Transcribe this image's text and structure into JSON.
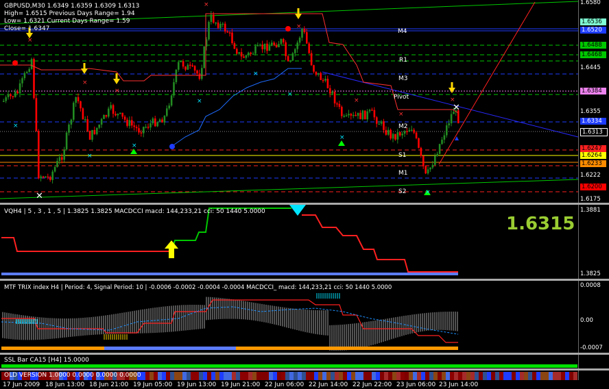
{
  "main": {
    "symbol_line": "GBPUSD,M30  1.6349 1.6359 1.6309 1.6313",
    "high_line": "High= 1.6515    Previous Days Range= 1.94",
    "low_line": "Low= 1.6321     Current Days Range= 1.59",
    "close_line": "Close= 1.6347",
    "levels": [
      "M4",
      "R1",
      "M3",
      "Pivot",
      "M2",
      "S1",
      "M1",
      "S2"
    ],
    "y_ticks": [
      "1.6580",
      "1.6445",
      "1.6355",
      "1.6313",
      "1.6222",
      "1.6175"
    ],
    "price_boxes": [
      "1.6536",
      "1.6520",
      "1.6488",
      "1.6468",
      "1.6384",
      "1.6334",
      "1.6264",
      "1.6247",
      "1.6233",
      "1.6200"
    ],
    "colors": {
      "bull": "#228b22",
      "bear": "#ff0000",
      "pivot_line": "#1e90ff",
      "channel": "#00c800"
    }
  },
  "vqh": {
    "title": "VQH4 | 5 , 3 , 1 , 5 | 1.3825 1.3825  MACDCCI  macd: 144,233,21 cci: 50 1440 5.0000",
    "y_ticks": [
      "1.3881",
      "1.3825"
    ],
    "big_price": "1.6315"
  },
  "trix": {
    "title": "MTF TRIX index H4 | Period: 4, Signal Period: 10 |  -0.0006 -0.0002 -0.0004 -0.0004  MACDCCI_ macd: 144,233,21 cci: 50 1440 5.0000",
    "y_ticks": [
      "0.0008",
      "0.00",
      "-0.0007"
    ]
  },
  "ssl": {
    "title": "SSL Bar  CA15 [H4] 15.0000"
  },
  "old": {
    "title": "OLD VERSION 1.0000 0.0000 0.0000 0.0000"
  },
  "x_axis": [
    "17 Jun 2009",
    "18 Jun 13:00",
    "18 Jun 21:00",
    "19 Jun 05:00",
    "19 Jun 13:00",
    "19 Jun 21:00",
    "22 Jun 06:00",
    "22 Jun 14:00",
    "22 Jun 22:00",
    "23 Jun 06:00",
    "23 Jun 14:00"
  ]
}
